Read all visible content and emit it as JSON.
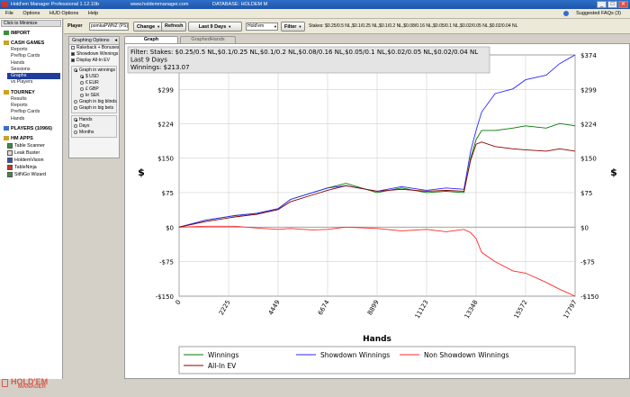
{
  "app": {
    "title": "Hold'em Manager Professional 1.12.10b",
    "site": "www.holdemmanager.com",
    "database": "DATABASE: HOLDEM M",
    "window_buttons": [
      "_",
      "□",
      "✕"
    ]
  },
  "menu": {
    "items": [
      "File",
      "Options",
      "HUD Options",
      "Help"
    ],
    "faq": "Suggested FAQs (3)"
  },
  "nav": {
    "minimize": "Click to Minimize",
    "import": "IMPORT",
    "cash_games": "CASH GAMES",
    "cash_items": [
      "Reports",
      "Preflop Cards",
      "Hands",
      "Sessions",
      "Graphs",
      "vs Players"
    ],
    "selected_index": 4,
    "tourney": "TOURNEY",
    "tourney_items": [
      "Results",
      "Reports",
      "Preflop Cards",
      "Hands"
    ],
    "players": "PLAYERS (10966)",
    "hm_apps": "HM APPS",
    "apps": [
      "Table Scanner",
      "Leak Buster",
      "HoldemVision",
      "TableNinja",
      "SitNGo Wizard"
    ],
    "logo_top": "HOLD'EM",
    "logo_bottom": "MANAGER"
  },
  "playerbar": {
    "label": "Player",
    "player_value": "pomkaPWNZ (PS)",
    "change": "Change",
    "refresh": "Refresh",
    "date_range": "Last  9 Days",
    "game_type": "Hold'em",
    "filter": "Filter",
    "stakes": "Stakes: $0.25/0.5 NL,$0.1/0.25 NL,$0.1/0.2 NL,$0.08/0.16 NL,$0.05/0.1 NL,$0.02/0.05 NL,$0.02/0.04 NL"
  },
  "graphing_options": {
    "title": "Graphing Options",
    "checkboxes": [
      {
        "label": "Rakeback + Bonuses",
        "checked": false
      },
      {
        "label": "Showdown Winnings",
        "checked": true
      },
      {
        "label": "Display All-In EV",
        "checked": true
      }
    ],
    "unit_group": [
      {
        "label": "Graph in winnings",
        "checked": true,
        "type": "radio"
      },
      {
        "label": "$ USD",
        "checked": true,
        "type": "radio",
        "indent": true
      },
      {
        "label": "€ EUR",
        "checked": false,
        "type": "radio",
        "indent": true
      },
      {
        "label": "£ GBP",
        "checked": false,
        "type": "radio",
        "indent": true
      },
      {
        "label": "kr SEK",
        "checked": false,
        "type": "radio",
        "indent": true
      },
      {
        "label": "Graph in big blinds",
        "checked": false,
        "type": "radio"
      },
      {
        "label": "Graph in big bets",
        "checked": false,
        "type": "radio"
      }
    ],
    "xaxis_group": [
      {
        "label": "Hands",
        "checked": true
      },
      {
        "label": "Days",
        "checked": false
      },
      {
        "label": "Months",
        "checked": false
      }
    ]
  },
  "tabs": [
    "Graph",
    "GraphedHands"
  ],
  "active_tab": 0,
  "chart_data": {
    "type": "line",
    "info_lines": [
      "Filter: Stakes: $0.25/0.5 NL,$0.1/0.25 NL,$0.1/0.2 NL,$0.08/0.16 NL,$0.05/0.1 NL,$0.02/0.05 NL,$0.02/0.04 NL",
      "Last  9 Days",
      "Winnings: $213.07"
    ],
    "xlabel": "Hands",
    "ylabel": "$",
    "xlim": [
      0,
      17797
    ],
    "ylim": [
      -150,
      374
    ],
    "x_ticks": [
      0,
      2225,
      4449,
      6674,
      8899,
      11123,
      13348,
      15572,
      17797
    ],
    "y_ticks": [
      -150,
      -75,
      0,
      75,
      150,
      224,
      299,
      374
    ],
    "y_tick_labels": [
      "-$150",
      "-$75",
      "$0",
      "$75",
      "$150",
      "$224",
      "$299",
      "$374"
    ],
    "grid": true,
    "legend_position": "bottom",
    "x": [
      0,
      1200,
      2500,
      3500,
      4449,
      5000,
      6000,
      6674,
      7500,
      8899,
      10000,
      11123,
      12000,
      12800,
      13100,
      13348,
      13600,
      14200,
      15000,
      15572,
      16500,
      17100,
      17797
    ],
    "series": [
      {
        "name": "Winnings",
        "color": "#007a00",
        "values": [
          0,
          15,
          25,
          30,
          40,
          60,
          75,
          85,
          95,
          75,
          85,
          75,
          78,
          75,
          150,
          190,
          210,
          210,
          215,
          220,
          215,
          225,
          220
        ]
      },
      {
        "name": "Showdown Winnings",
        "color": "#2a2aff",
        "values": [
          0,
          15,
          25,
          30,
          40,
          60,
          75,
          85,
          90,
          78,
          88,
          80,
          85,
          82,
          165,
          210,
          250,
          290,
          300,
          320,
          330,
          355,
          374
        ]
      },
      {
        "name": "Non Showdown Winnings",
        "color": "#ff2a2a",
        "values": [
          0,
          2,
          2,
          -2,
          -5,
          -3,
          -6,
          -5,
          0,
          -3,
          -8,
          -5,
          -10,
          -5,
          -12,
          -25,
          -55,
          -75,
          -95,
          -100,
          -120,
          -135,
          -150
        ]
      },
      {
        "name": "All-In EV",
        "color": "#8b0000",
        "values": [
          0,
          12,
          22,
          28,
          38,
          55,
          70,
          80,
          90,
          78,
          82,
          78,
          80,
          78,
          145,
          180,
          185,
          175,
          170,
          168,
          165,
          170,
          165
        ]
      }
    ]
  }
}
